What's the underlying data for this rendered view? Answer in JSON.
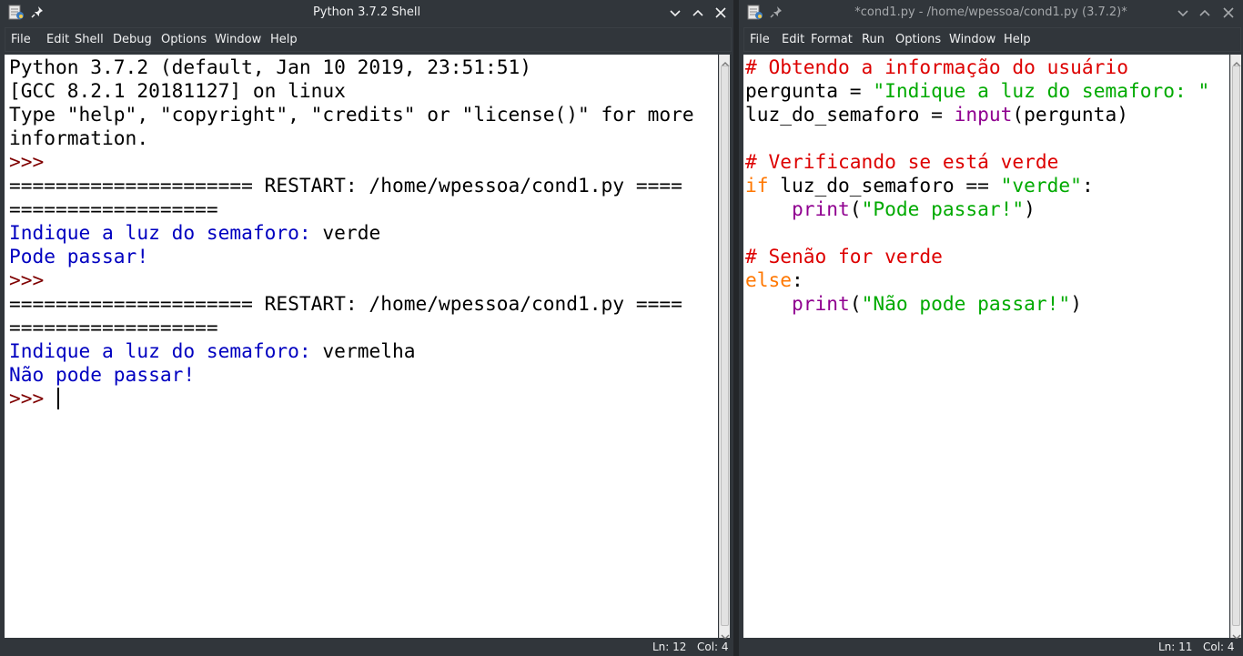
{
  "shell": {
    "title": "Python 3.7.2 Shell",
    "menu": [
      "File",
      "Edit",
      "Shell",
      "Debug",
      "Options",
      "Window",
      "Help"
    ],
    "lines": {
      "l1": "Python 3.7.2 (default, Jan 10 2019, 23:51:51)",
      "l2": "[GCC 8.2.1 20181127] on linux",
      "l3": "Type \"help\", \"copyright\", \"credits\" or \"license()\" for more",
      "l4": "information.",
      "prompt": ">>>",
      "restart_a": "===================== RESTART: /home/wpessoa/cond1.py ====",
      "restart_b": "==================",
      "input_prompt": "Indique a luz do semaforo: ",
      "input_1": "verde",
      "output_1": "Pode passar!",
      "input_2": "vermelha",
      "output_2": "Não pode passar!"
    },
    "status": {
      "ln": "Ln: 12",
      "col": "Col: 4"
    }
  },
  "editor": {
    "title": "*cond1.py - /home/wpessoa/cond1.py (3.7.2)*",
    "menu": [
      "File",
      "Edit",
      "Format",
      "Run",
      "Options",
      "Window",
      "Help"
    ],
    "code": {
      "c1": "# Obtendo a informação do usuário",
      "l2_var": "pergunta = ",
      "l2_str": "\"Indique a luz do semaforo: \"",
      "l3_var": "luz_do_semaforo = ",
      "l3_fn": "input",
      "l3_args": "(pergunta)",
      "c2": "# Verificando se está verde",
      "kw_if": "if",
      "l6_cond": " luz_do_semaforo == ",
      "l6_str": "\"verde\"",
      "colon": ":",
      "indent": "    ",
      "fn_print": "print",
      "paren_open": "(",
      "paren_close": ")",
      "str_ok": "\"Pode passar!\"",
      "c3": "# Senão for verde",
      "kw_else": "else",
      "str_no": "\"Não pode passar!\""
    },
    "status": {
      "ln": "Ln: 11",
      "col": "Col: 4"
    }
  }
}
